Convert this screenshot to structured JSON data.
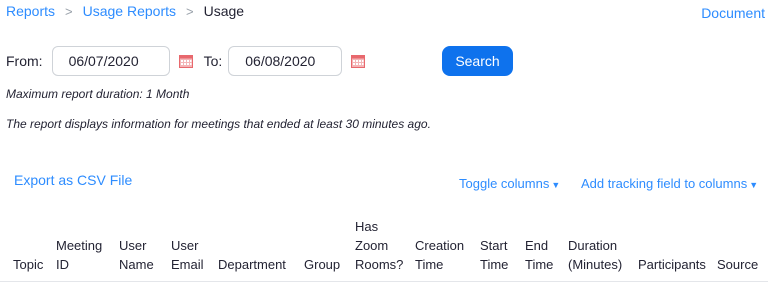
{
  "breadcrumb": {
    "items": [
      "Reports",
      "Usage Reports",
      "Usage"
    ],
    "separator": ">"
  },
  "document_link": "Document",
  "date_range": {
    "from_label": "From:",
    "from_value": "06/07/2020",
    "to_label": "To:",
    "to_value": "06/08/2020",
    "search_label": "Search"
  },
  "notes": {
    "max_duration": "Maximum report duration: 1 Month",
    "report_info": "The report displays information for meetings that ended at least 30 minutes ago."
  },
  "actions": {
    "export": "Export as CSV File",
    "toggle_columns": "Toggle columns",
    "add_tracking": "Add tracking field to columns"
  },
  "table": {
    "columns": [
      [
        "Topic"
      ],
      [
        "Meeting",
        "ID"
      ],
      [
        "User",
        "Name"
      ],
      [
        "User",
        "Email"
      ],
      [
        "Department"
      ],
      [
        "Group"
      ],
      [
        "Has",
        "Zoom",
        "Rooms?"
      ],
      [
        "Creation",
        "Time"
      ],
      [
        "Start",
        "Time"
      ],
      [
        "End",
        "Time"
      ],
      [
        "Duration",
        "(Minutes)"
      ],
      [
        "Participants"
      ],
      [
        "Source"
      ]
    ]
  },
  "colors": {
    "link": "#2d8cff",
    "primary_button": "#0e72ed",
    "text": "#232333",
    "calendar_icon": "#e8686d"
  },
  "icons": {
    "calendar": "calendar-icon",
    "caret": "caret-down-icon"
  }
}
